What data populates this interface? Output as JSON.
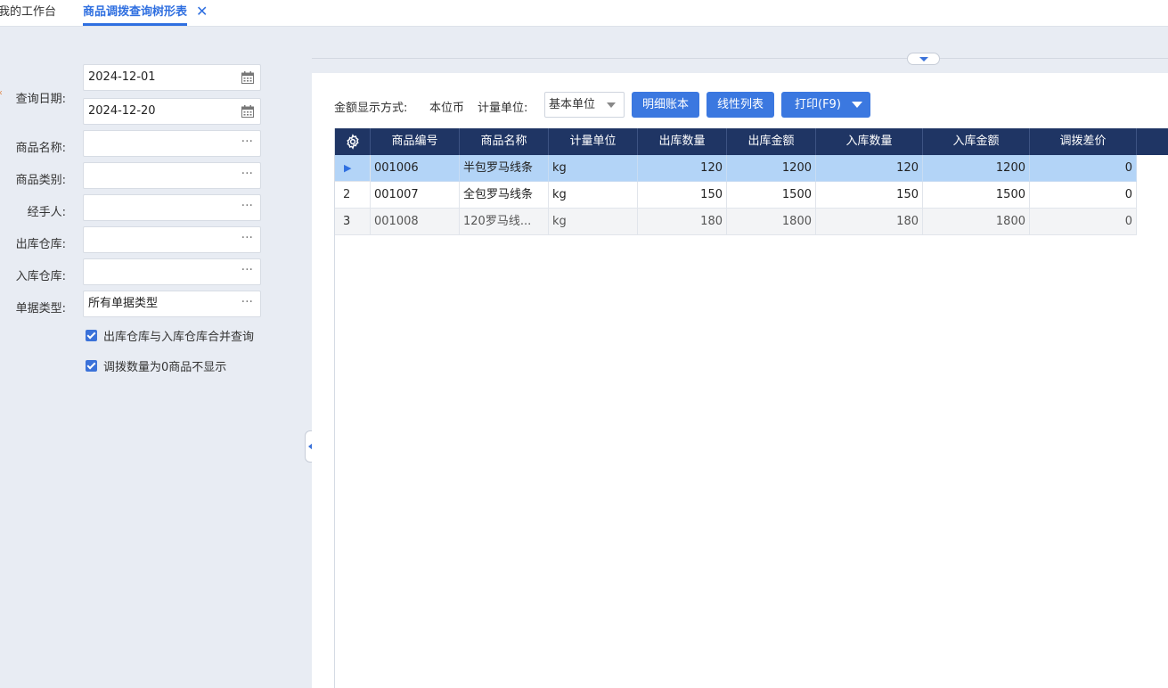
{
  "tabs": {
    "home": "我的工作台",
    "active": "商品调拨查询树形表",
    "close_icon": "close-icon"
  },
  "filters": {
    "date_label": "查询日期:",
    "date_from": "2024-12-01",
    "date_to": "2024-12-20",
    "product_name_label": "商品名称:",
    "product_name": "",
    "product_category_label": "商品类别:",
    "product_category": "",
    "handler_label": "经手人:",
    "handler": "",
    "out_warehouse_label": "出库仓库:",
    "out_warehouse": "",
    "in_warehouse_label": "入库仓库:",
    "in_warehouse": "",
    "doc_type_label": "单据类型:",
    "doc_type": "所有单据类型",
    "merge_warehouse_label": "出库仓库与入库仓库合并查询",
    "merge_warehouse_checked": true,
    "hide_zero_label": "调拨数量为0商品不显示",
    "hide_zero_checked": true,
    "dots": "···"
  },
  "toolbar": {
    "amount_mode_label": "金额显示方式:",
    "amount_mode_value": "本位币",
    "unit_label": "计量单位:",
    "unit_value": "基本单位",
    "detail_ledger": "明细账本",
    "linear_list": "线性列表",
    "print": "打印(F9)"
  },
  "grid": {
    "columns": [
      "商品编号",
      "商品名称",
      "计量单位",
      "出库数量",
      "出库金额",
      "入库数量",
      "入库金额",
      "调拨差价"
    ],
    "rows": [
      {
        "index": "▶",
        "code": "001006",
        "name": "半包罗马线条",
        "unit": "kg",
        "out_qty": "120",
        "out_amount": "1200",
        "in_qty": "120",
        "in_amount": "1200",
        "diff": "0"
      },
      {
        "index": "2",
        "code": "001007",
        "name": "全包罗马线条",
        "unit": "kg",
        "out_qty": "150",
        "out_amount": "1500",
        "in_qty": "150",
        "in_amount": "1500",
        "diff": "0"
      },
      {
        "index": "3",
        "code": "001008",
        "name": "120罗马线...",
        "unit": "kg",
        "out_qty": "180",
        "out_amount": "1800",
        "in_qty": "180",
        "in_amount": "1800",
        "diff": "0"
      }
    ]
  },
  "colors": {
    "accent": "#3b78e0",
    "header_bg": "#1f3564",
    "selected_row": "#b3d4f7"
  }
}
